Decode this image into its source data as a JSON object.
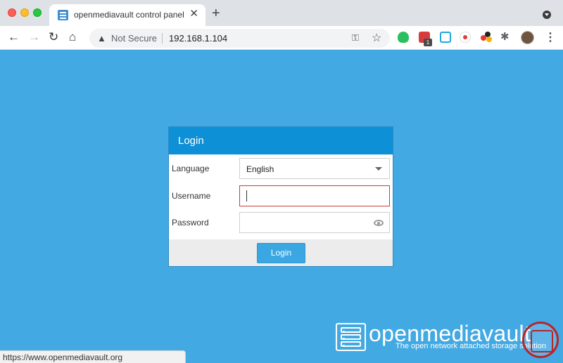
{
  "browser": {
    "tab": {
      "title": "openmediavault control panel - ",
      "close_glyph": "✕",
      "icon": "openmediavault-favicon"
    },
    "new_tab_glyph": "+",
    "nav": {
      "back": "←",
      "forward": "→",
      "reload": "↻",
      "home": "⌂"
    },
    "address": {
      "security_label": "Not Secure",
      "url": "192.168.1.104",
      "warning_glyph": "▲"
    },
    "key_glyph": "⚿",
    "star_glyph": "☆",
    "extension_badge": "1",
    "puzzle_glyph": "✱",
    "menu_glyph": "⋮",
    "status_url": "https://www.openmediavault.org"
  },
  "login": {
    "title": "Login",
    "language_label": "Language",
    "language_value": "English",
    "username_label": "Username",
    "username_value": "",
    "password_label": "Password",
    "password_value": "",
    "submit_label": "Login"
  },
  "brand": {
    "name": "openmediavault",
    "tagline": "The open network attached storage solution"
  },
  "colors": {
    "background": "#43a9e3",
    "panel_header": "#0e90d6",
    "button": "#3aa7e3",
    "invalid_border": "#cf3a3a"
  }
}
